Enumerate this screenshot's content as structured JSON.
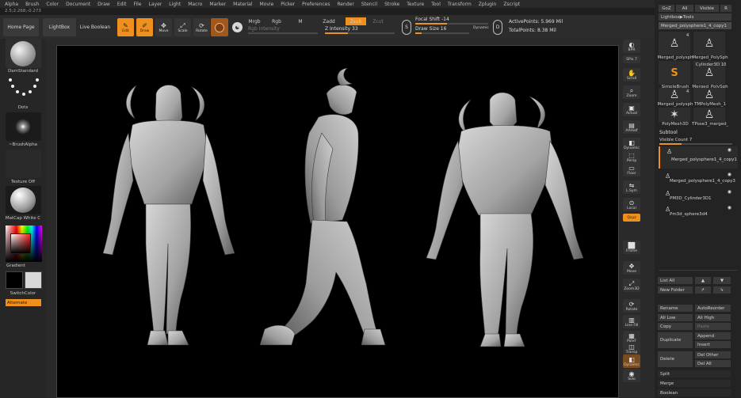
{
  "menu": [
    "Alpha",
    "Brush",
    "Color",
    "Document",
    "Draw",
    "Edit",
    "File",
    "Layer",
    "Light",
    "Macro",
    "Marker",
    "Material",
    "Movie",
    "Picker",
    "Preferences",
    "Render",
    "Stencil",
    "Stroke",
    "Texture",
    "Tool",
    "Transform",
    "Zplugin",
    "Zscript"
  ],
  "coords": "2.5;2.268;-0.273",
  "toolbar": {
    "home_page": "Home Page",
    "lightbox": "LightBox",
    "live_boolean": "Live Boolean",
    "edit": "Edit",
    "draw": "Draw",
    "move": "Move",
    "scale": "Scale",
    "rotate": "Rotate",
    "mrgb": "Mrgb",
    "rgb": "Rgb",
    "m": "M",
    "zadd": "Zadd",
    "zsub": "Zsub",
    "zcut": "Zcut",
    "rgb_intensity": "Rgb Intensity",
    "z_intensity": "Z Intensity 33",
    "focal_shift": "Focal Shift -14",
    "draw_size": "Draw Size 16",
    "dynamic": "Dynamic",
    "active_points": "ActivePoints: 5.969 Mil",
    "total_points": "TotalPoints: 8.38 Mil",
    "s_label": "S",
    "d_label": "D"
  },
  "left_tray": {
    "brush": "DamStandard",
    "stroke": "Dots",
    "alpha": "~BrushAlpha",
    "texture": "Texture Off",
    "material": "MatCap White C",
    "gradient": "Gradient",
    "switch_color": "SwitchColor",
    "alternate": "Alternate"
  },
  "shelf": [
    {
      "label": "BPR",
      "icon": "render-icon"
    },
    {
      "label": "SPix 7",
      "icon": "spix-icon"
    },
    {
      "label": "Scroll",
      "icon": "hand-icon"
    },
    {
      "label": "Zoom",
      "icon": "zoom-icon"
    },
    {
      "label": "Actual",
      "icon": "actual-icon"
    },
    {
      "label": "AAHalf",
      "icon": "aahalf-icon"
    },
    {
      "label": "Dynamic",
      "icon": "dynamic-icon"
    },
    {
      "label": "Persp",
      "icon": "persp-icon"
    },
    {
      "label": "Floor",
      "icon": "floor-icon"
    },
    {
      "label": "L.Sym",
      "icon": "lsym-icon"
    },
    {
      "label": "Local",
      "icon": "local-icon"
    },
    {
      "label": "Qxyz",
      "icon": "xyz-icon"
    },
    {
      "label": "Frame",
      "icon": "frame-icon"
    },
    {
      "label": "Move",
      "icon": "move-icon"
    },
    {
      "label": "Zoom3D",
      "icon": "zoom3d-icon"
    },
    {
      "label": "Rotate",
      "icon": "rotate-icon"
    },
    {
      "label": "Line Fill",
      "icon": "linefill-icon"
    },
    {
      "label": "PolyF",
      "icon": "polyf-icon"
    },
    {
      "label": "Transp",
      "icon": "transp-icon"
    },
    {
      "label": "Dynamic",
      "icon": "dynamic-icon"
    },
    {
      "label": "Solo",
      "icon": "solo-icon"
    }
  ],
  "right_panel": {
    "goz": "GoZ",
    "all": "All",
    "visible": "Visible",
    "r": "R",
    "lightbox_tools": "Lightbox▶Tools",
    "current_tool": "Merged_polysphere1_4_copy1",
    "tools": [
      {
        "label": "Merged_polysph",
        "num": "4"
      },
      {
        "label": "Merged_PolySph",
        "num": ""
      },
      {
        "label": "SimpleBrush",
        "num": ""
      },
      {
        "label": "Merged_PolySph",
        "num": "10"
      },
      {
        "label": "Merged_polysph",
        "num": "4"
      },
      {
        "label": "TMPolyMesh_1",
        "num": ""
      },
      {
        "label": "PolyMesh3D",
        "num": ""
      },
      {
        "label": "TPose3_merged_",
        "num": ""
      },
      {
        "label": "Cylinder3D",
        "num": ""
      }
    ],
    "subtool_title": "Subtool",
    "visible_count": "Visible Count 7",
    "subtools": [
      "Merged_polysphere1_4_copy1",
      "Merged_polysphere1_4_copy3",
      "PM3D_Cylinder3D1",
      "Pm3d_sphere3d4"
    ],
    "list_all": "List All",
    "new_folder": "New Folder",
    "rename": "Rename",
    "auto_reorder": "AutoReorder",
    "all_low": "All Low",
    "all_high": "All High",
    "copy": "Copy",
    "paste": "Paste",
    "duplicate": "Duplicate",
    "append": "Append",
    "insert": "Insert",
    "delete": "Delete",
    "del_other": "Del Other",
    "del_all": "Del All",
    "split": "Split",
    "merge": "Merge",
    "boolean": "Boolean"
  },
  "colors": {
    "accent": "#ee8f1e",
    "background": "#1e1e1e",
    "canvas": "#000000"
  }
}
